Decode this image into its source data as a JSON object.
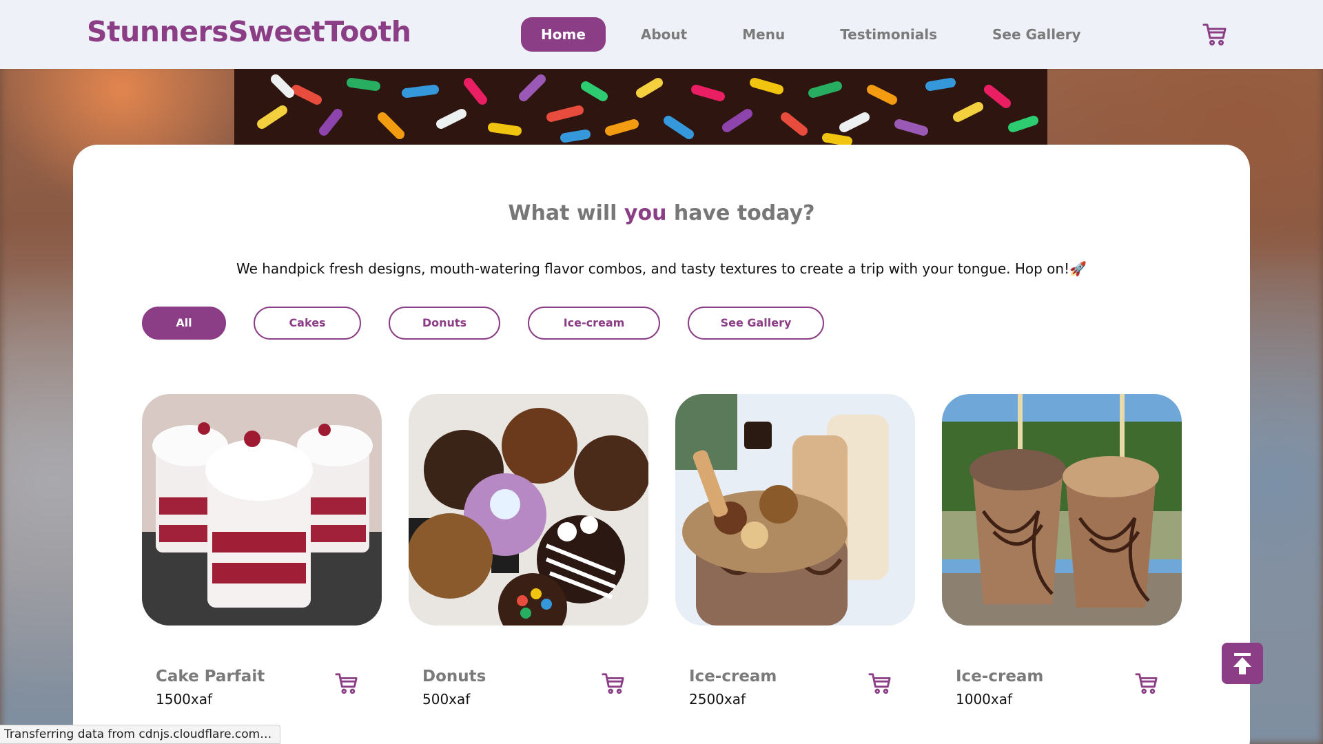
{
  "header": {
    "logo": "StunnersSweetTooth",
    "nav": [
      "Home",
      "About",
      "Menu",
      "Testimonials",
      "See Gallery"
    ],
    "active_nav": "Home",
    "cart_icon": "cart-icon"
  },
  "main": {
    "heading_pre": "What will ",
    "heading_accent": "you",
    "heading_post": " have today?",
    "subtext": "We handpick fresh designs, mouth-watering flavor combos, and tasty textures to create a trip with your tongue. Hop on!🚀",
    "filters": [
      "All",
      "Cakes",
      "Donuts",
      "Ice-cream",
      "See Gallery"
    ],
    "active_filter": "All",
    "products": [
      {
        "name": "Cake Parfait",
        "price": "1500xaf"
      },
      {
        "name": "Donuts",
        "price": "500xaf"
      },
      {
        "name": "Ice-cream",
        "price": "2500xaf"
      },
      {
        "name": "Ice-cream",
        "price": "1000xaf"
      }
    ]
  },
  "status_bar": "Transferring data from cdnjs.cloudflare.com…",
  "colors": {
    "accent": "#8b3d85",
    "header_bg": "#eef1f7",
    "muted_text": "#7b7b7b"
  }
}
